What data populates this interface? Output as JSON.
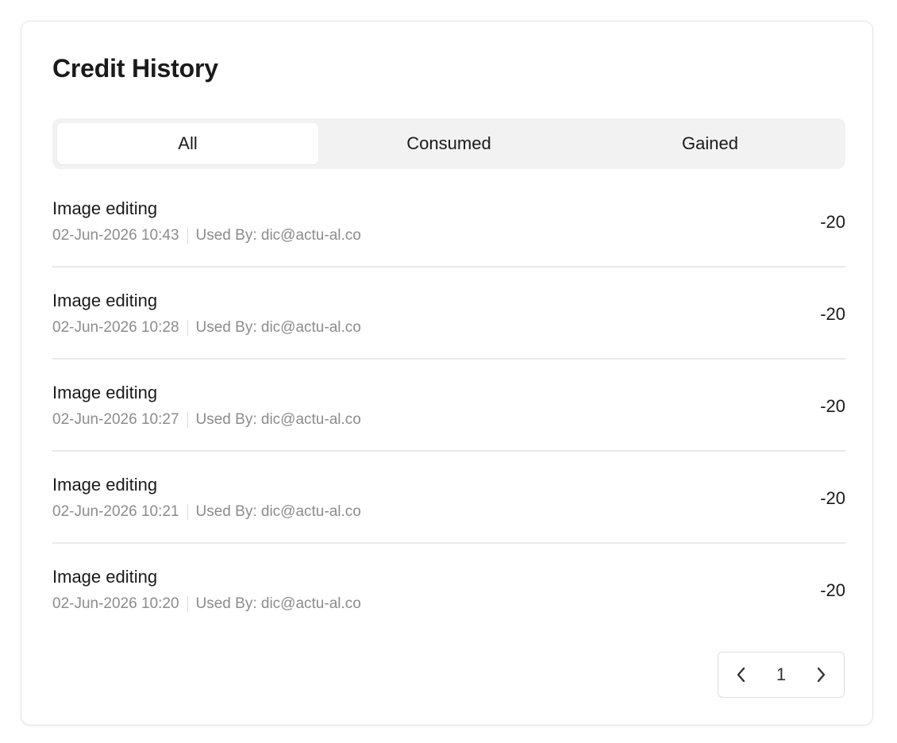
{
  "title": "Credit History",
  "tabs": [
    {
      "label": "All",
      "active": true
    },
    {
      "label": "Consumed",
      "active": false
    },
    {
      "label": "Gained",
      "active": false
    }
  ],
  "rows": [
    {
      "title": "Image editing",
      "datetime": "02-Jun-2026 10:43",
      "used_by": "Used By: dic@actu-al.co",
      "amount": "-20"
    },
    {
      "title": "Image editing",
      "datetime": "02-Jun-2026 10:28",
      "used_by": "Used By: dic@actu-al.co",
      "amount": "-20"
    },
    {
      "title": "Image editing",
      "datetime": "02-Jun-2026 10:27",
      "used_by": "Used By: dic@actu-al.co",
      "amount": "-20"
    },
    {
      "title": "Image editing",
      "datetime": "02-Jun-2026 10:21",
      "used_by": "Used By: dic@actu-al.co",
      "amount": "-20"
    },
    {
      "title": "Image editing",
      "datetime": "02-Jun-2026 10:20",
      "used_by": "Used By: dic@actu-al.co",
      "amount": "-20"
    }
  ],
  "pagination": {
    "current_page": "1",
    "prev_icon": "chevron-left-icon",
    "next_icon": "chevron-right-icon"
  }
}
